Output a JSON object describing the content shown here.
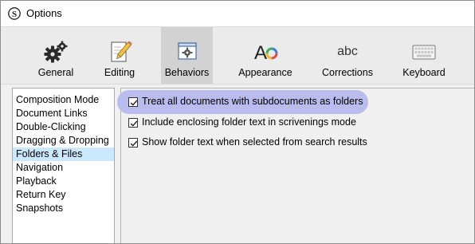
{
  "window": {
    "title": "Options"
  },
  "toolbar": {
    "items": [
      {
        "label": "General",
        "icon": "gears-icon"
      },
      {
        "label": "Editing",
        "icon": "pencil-paper-icon"
      },
      {
        "label": "Behaviors",
        "icon": "window-gear-icon",
        "selected": true
      },
      {
        "label": "Appearance",
        "icon": "font-color-icon"
      },
      {
        "label": "Corrections",
        "icon": "abc-text-icon",
        "icon_text": "abc"
      },
      {
        "label": "Keyboard",
        "icon": "keyboard-icon"
      }
    ]
  },
  "sidebar": {
    "items": [
      {
        "label": "Composition Mode"
      },
      {
        "label": "Document Links"
      },
      {
        "label": "Double-Clicking"
      },
      {
        "label": "Dragging & Dropping"
      },
      {
        "label": "Folders & Files",
        "selected": true
      },
      {
        "label": "Navigation"
      },
      {
        "label": "Playback"
      },
      {
        "label": "Return Key"
      },
      {
        "label": "Snapshots"
      }
    ]
  },
  "options": [
    {
      "label": "Treat all documents with subdocuments as folders",
      "checked": true,
      "highlighted": true
    },
    {
      "label": "Include enclosing folder text in scrivenings mode",
      "checked": true
    },
    {
      "label": "Show folder text when selected from search results",
      "checked": true
    }
  ],
  "colors": {
    "highlight": "#b9bcec",
    "selected_sidebar": "#cce8ff",
    "selected_toolbar": "#d2d2d2"
  }
}
